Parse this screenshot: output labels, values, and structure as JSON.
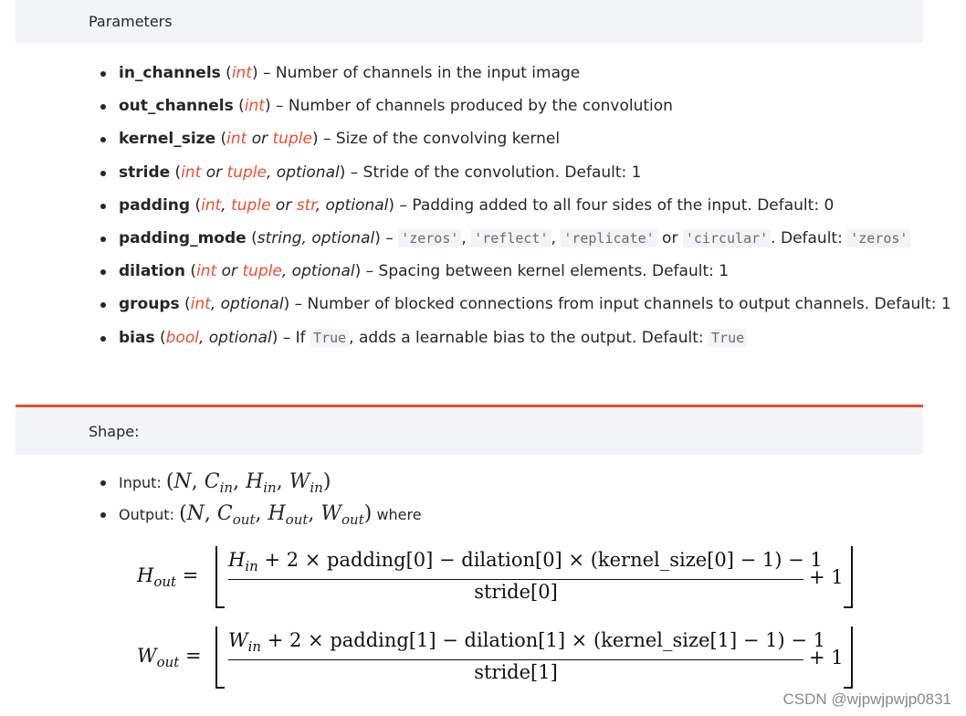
{
  "parameters_header": "Parameters",
  "params": [
    {
      "name": "in_channels",
      "open": " (",
      "types": [
        {
          "t": "int",
          "link": true
        }
      ],
      "close": ")",
      "desc": " – Number of channels in the input image"
    },
    {
      "name": "out_channels",
      "open": " (",
      "types": [
        {
          "t": "int",
          "link": true
        }
      ],
      "close": ")",
      "desc": " – Number of channels produced by the convolution"
    },
    {
      "name": "kernel_size",
      "open": " (",
      "types": [
        {
          "t": "int",
          "link": true
        },
        {
          "t": " or ",
          "link": false
        },
        {
          "t": "tuple",
          "link": true
        }
      ],
      "close": ")",
      "desc": " – Size of the convolving kernel"
    },
    {
      "name": "stride",
      "open": " (",
      "types": [
        {
          "t": "int",
          "link": true
        },
        {
          "t": " or ",
          "link": false
        },
        {
          "t": "tuple",
          "link": true
        },
        {
          "t": ", optional",
          "link": false
        }
      ],
      "close": ")",
      "desc": " – Stride of the convolution. Default: 1"
    },
    {
      "name": "padding",
      "open": " (",
      "types": [
        {
          "t": "int",
          "link": true
        },
        {
          "t": ", ",
          "link": false
        },
        {
          "t": "tuple",
          "link": true
        },
        {
          "t": " or ",
          "link": false
        },
        {
          "t": "str",
          "link": true
        },
        {
          "t": ", optional",
          "link": false
        }
      ],
      "close": ")",
      "desc": " – Padding added to all four sides of the input. Default: 0"
    },
    {
      "name": "padding_mode",
      "open": " (",
      "types": [
        {
          "t": "string, optional",
          "link": false
        }
      ],
      "close": ")",
      "desc": " – ",
      "codes": [
        "'zeros'",
        "'reflect'",
        "'replicate'",
        "'circular'"
      ],
      "codes_tail": ". Default: ",
      "default_code": "'zeros'"
    },
    {
      "name": "dilation",
      "open": " (",
      "types": [
        {
          "t": "int",
          "link": true
        },
        {
          "t": " or ",
          "link": false
        },
        {
          "t": "tuple",
          "link": true
        },
        {
          "t": ", optional",
          "link": false
        }
      ],
      "close": ")",
      "desc": " – Spacing between kernel elements. Default: 1"
    },
    {
      "name": "groups",
      "open": " (",
      "types": [
        {
          "t": "int",
          "link": true
        },
        {
          "t": ", optional",
          "link": false
        }
      ],
      "close": ")",
      "desc": " – Number of blocked connections from input channels to output channels. Default: 1"
    },
    {
      "name": "bias",
      "open": " (",
      "types": [
        {
          "t": "bool",
          "link": true
        },
        {
          "t": ", optional",
          "link": false
        }
      ],
      "close": ")",
      "desc": " – If ",
      "inline_code": "True",
      "desc2": ", adds a learnable bias to the output. Default: ",
      "default_code": "True"
    }
  ],
  "shape_header": "Shape:",
  "shape": {
    "input_label": "Input: ",
    "output_label": "Output: ",
    "output_suffix": " where"
  },
  "equations": {
    "h_numerator": "H_in + 2 × padding[0] − dilation[0] × (kernel_size[0] − 1) − 1",
    "h_denominator": "stride[0]",
    "w_numerator": "W_in + 2 × padding[1] − dilation[1] × (kernel_size[1] − 1) − 1",
    "w_denominator": "stride[1]",
    "plus_one": "+ 1"
  },
  "watermark": "CSDN @wjpwjpwjp0831",
  "colors": {
    "accent": "#ee4c2c",
    "band": "#f3f4f7",
    "text": "#262626"
  }
}
